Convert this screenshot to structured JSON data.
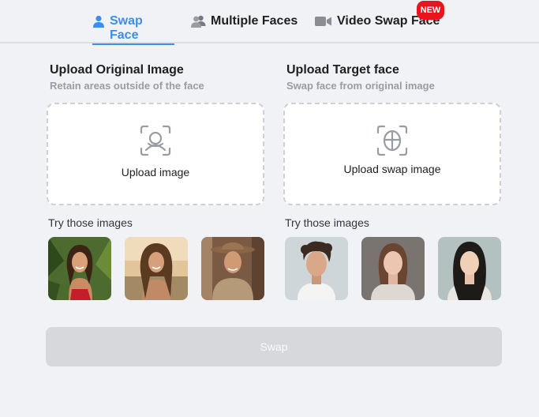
{
  "tabs": [
    {
      "label": "Swap Face",
      "icon": "user-icon",
      "active": true
    },
    {
      "label": "Multiple Faces",
      "icon": "users-icon",
      "active": false
    },
    {
      "label": "Video Swap Face",
      "icon": "video-camera-icon",
      "active": false,
      "badge": "NEW"
    }
  ],
  "original": {
    "title": "Upload Original Image",
    "subtitle": "Retain areas outside of the face",
    "upload_label": "Upload image",
    "upload_icon": "face-scan-icon",
    "try_label": "Try those images",
    "samples": [
      "sample-woman-jungle",
      "sample-woman-sunset",
      "sample-cowboy"
    ]
  },
  "target": {
    "title": "Upload Target face",
    "subtitle": "Swap face from original image",
    "upload_label": "Upload swap image",
    "upload_icon": "face-target-icon",
    "try_label": "Try those images",
    "samples": [
      "sample-man-curly",
      "sample-woman-auburn",
      "sample-woman-asian"
    ]
  },
  "action": {
    "swap_label": "Swap"
  },
  "colors": {
    "accent": "#3d8ee8",
    "badge": "#e8141e",
    "disabled_button": "#d7d8db"
  }
}
